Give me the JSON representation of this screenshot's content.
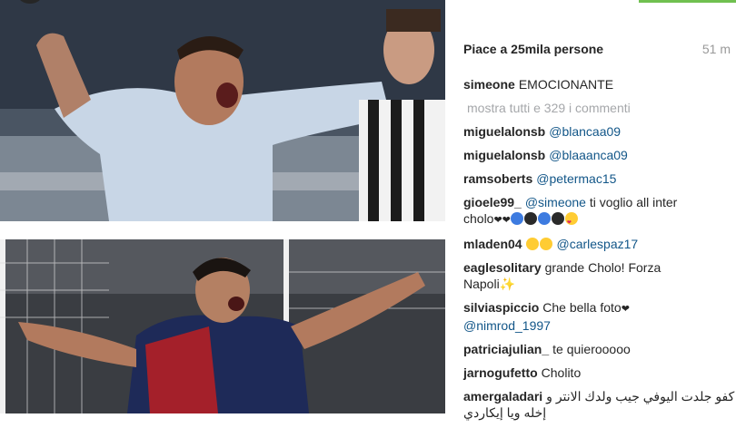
{
  "post": {
    "likes_text": "Piace a 25mila persone",
    "time_text": "51 m",
    "caption": {
      "user": "simeone",
      "text": "EMOCIONANTE"
    },
    "show_all_text": "mostra tutti e 329 i commenti"
  },
  "comments": [
    {
      "user": "miguelalonsb",
      "mention": "@blancaa09"
    },
    {
      "user": "miguelalonsb",
      "mention": "@blaaanca09"
    },
    {
      "user": "ramsoberts",
      "mention": "@petermac15"
    },
    {
      "user": "gioele99_",
      "mention": "@simeone",
      "text": "ti voglio all inter",
      "text2": "cholo"
    },
    {
      "user": "mladen04",
      "mention": "@carlespaz17"
    },
    {
      "user": "eaglesolitary",
      "text": "grande Cholo! Forza",
      "text2": "Napoli"
    },
    {
      "user": "silviaspiccio",
      "text": "Che bella foto",
      "mention2": "@nimrod_1997"
    },
    {
      "user": "patriciajulian_",
      "text": "te quierooooo"
    },
    {
      "user": "jarnogufetto",
      "text": "Cholito"
    },
    {
      "user": "amergaladari",
      "text": "كفو جلدت اليوفي جيب ولدك الانتر و",
      "text2": "إخله ويا إيكاردي"
    }
  ],
  "emoji": {
    "c4": [
      "heart-icon",
      "heart-icon",
      "blue-circle-icon",
      "black-circle-icon",
      "blue-circle-icon",
      "black-circle-icon",
      "heart-eyes-icon"
    ],
    "c5": [
      "joy-icon",
      "joy-icon"
    ],
    "c6": [
      "sparkles-icon"
    ],
    "c7": [
      "heart-icon"
    ]
  },
  "colors": {
    "mention": "#125688",
    "username": "#262626",
    "muted": "#999999",
    "follow_button": "#70c050"
  }
}
